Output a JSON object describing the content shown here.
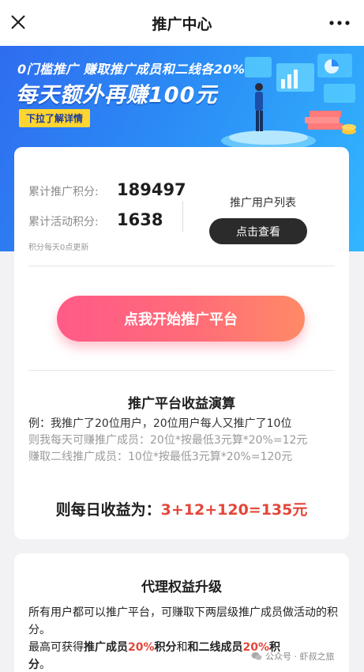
{
  "nav": {
    "title": "推广中心",
    "close_icon": "close-icon",
    "more_icon": "more-icon"
  },
  "banner": {
    "line1": "0门槛推广  赚取推广成员和二线各20%",
    "line2": "每天额外再赚100元",
    "pill": "下拉了解详情",
    "colors": {
      "from": "#2f6cf0",
      "to": "#33b6ff",
      "pill": "#ffd531"
    }
  },
  "stats": {
    "total_points_label": "累计推广积分:",
    "total_points_value": "189497",
    "activity_points_label": "累计活动积分:",
    "activity_points_value": "1638",
    "note": "积分每天0点更新",
    "users_list_title": "推广用户列表",
    "view_button": "点击查看"
  },
  "start_button": "点我开始推广平台",
  "calc": {
    "title": "推广平台收益演算",
    "line1": "例：我推广了20位用户，20位用户每人又推广了10位",
    "line2": "则我每天可赚推广成员：20位*按最低3元算*20%=12元",
    "line3": "赚取二线推广成员：10位*按最低3元算*20%=120元",
    "total_label": "则每日收益为：",
    "total_value": "3+12+120=135元"
  },
  "agent": {
    "title": "代理权益升级",
    "p1": "所有用户都可以推广平台，可赚取下两层级推广成员做活动的积分。",
    "p2_a": "最高可获得",
    "p2_b": "推广成员",
    "p2_c": "20%",
    "p2_d": "积分",
    "p2_e": "和",
    "p2_f": "和二线成员",
    "p2_g": "20%",
    "p2_h": "积",
    "p2_i": "分",
    "p2_j": "。"
  },
  "watermark": "公众号 · 虾叔之旅",
  "colors": {
    "accent_red": "#e4463a",
    "button_pink": "#ff5a88",
    "dark_button": "#2b2b2b"
  }
}
